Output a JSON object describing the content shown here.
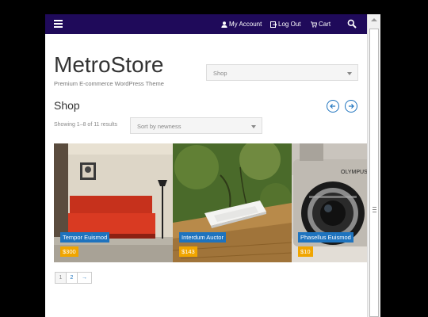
{
  "topbar": {
    "my_account": "My Account",
    "log_out": "Log Out",
    "cart": "Cart"
  },
  "header": {
    "logo": "MetroStore",
    "tagline": "Premium E-commerce WordPress Theme",
    "shop_select": "Shop"
  },
  "page": {
    "title": "Shop",
    "result_count": "Showing 1–8 of 11 results",
    "sort_select": "Sort by newness"
  },
  "products": [
    {
      "name": "Tempor Euismod",
      "price": "$300"
    },
    {
      "name": "Interdum Auctor",
      "price": "$143"
    },
    {
      "name": "Phasellus Euismod",
      "price": "$10"
    }
  ],
  "pagination": {
    "pages": [
      "1",
      "2"
    ],
    "next": "→"
  },
  "colors": {
    "topbar": "#1f0a5a",
    "accent": "#1e73be",
    "price": "#f0a500"
  }
}
